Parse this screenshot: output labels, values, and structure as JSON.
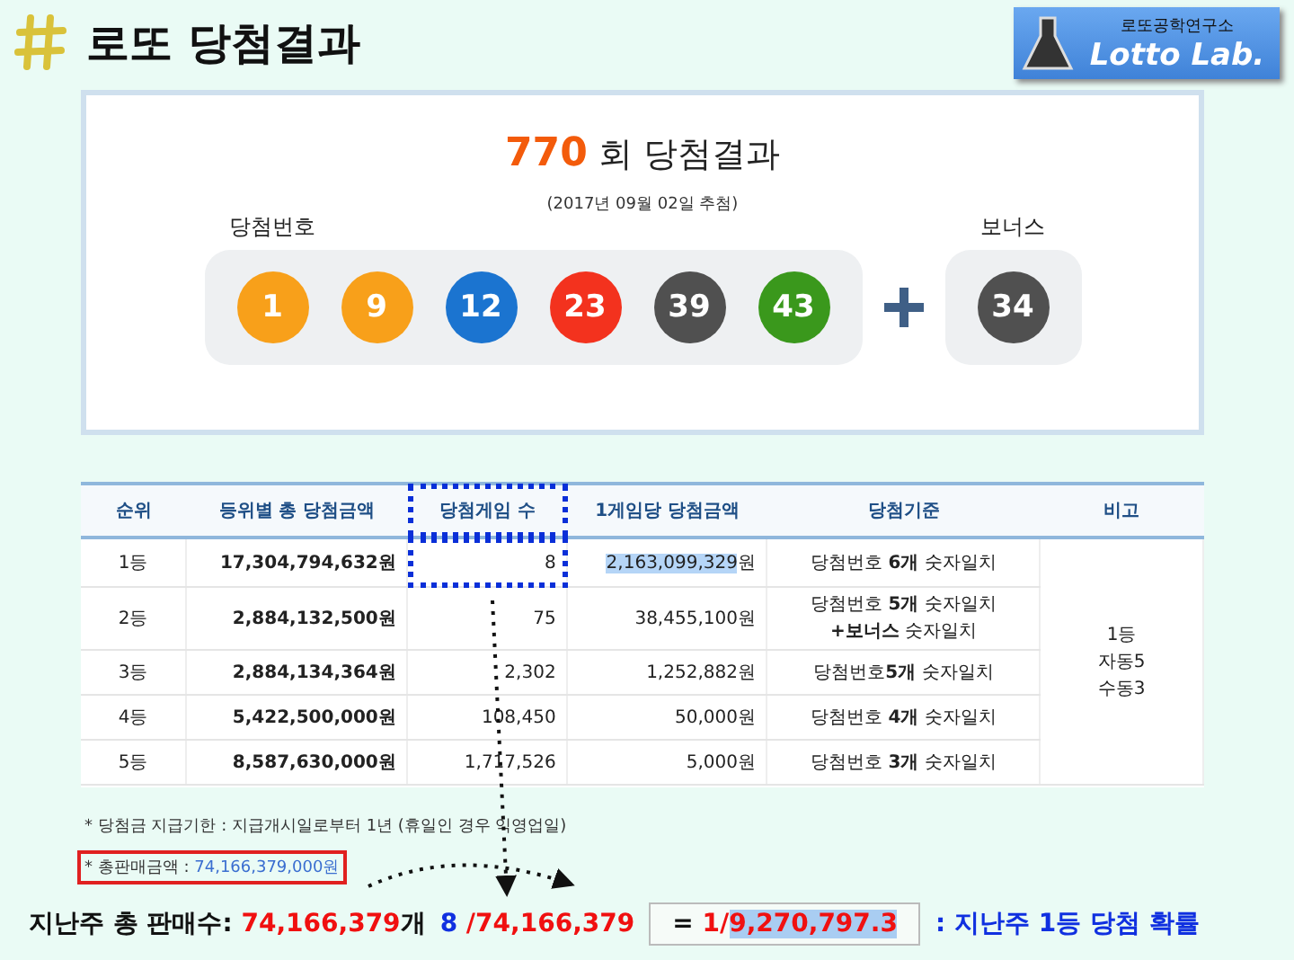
{
  "header": {
    "title": "로또 당첨결과",
    "logo": {
      "subtitle": "로또공학연구소",
      "name": "Lotto Lab."
    }
  },
  "draw": {
    "round": "770",
    "title_suffix": "회 당첨결과",
    "date": "(2017년 09월 02일 추첨)",
    "numbers_label": "당첨번호",
    "bonus_label": "보너스",
    "numbers": [
      {
        "value": "1",
        "color": "#f8a01a"
      },
      {
        "value": "9",
        "color": "#f8a01a"
      },
      {
        "value": "12",
        "color": "#1b74d0"
      },
      {
        "value": "23",
        "color": "#f3321e"
      },
      {
        "value": "39",
        "color": "#505050"
      },
      {
        "value": "43",
        "color": "#3a981c"
      }
    ],
    "bonus": {
      "value": "34",
      "color": "#505050"
    }
  },
  "table": {
    "columns": [
      {
        "label": "순위",
        "boxed": false
      },
      {
        "label": "등위별 총 당첨금액",
        "boxed": false
      },
      {
        "label": "당첨게임 수",
        "boxed": true
      },
      {
        "label": "1게임당 당첨금액",
        "boxed": false
      },
      {
        "label": "당첨기준",
        "boxed": false
      },
      {
        "label": "비고",
        "boxed": false
      }
    ],
    "rows": [
      {
        "rank": "1등",
        "total": "17,304,794,632원",
        "count": "8",
        "count_boxed": true,
        "per_game": "2,163,099,329",
        "unit": "원",
        "highlighted": true,
        "criteria": [
          "당첨번호 **6개** 숫자일치"
        ]
      },
      {
        "rank": "2등",
        "total": "2,884,132,500원",
        "count": "75",
        "count_boxed": false,
        "per_game": "38,455,100",
        "unit": "원",
        "highlighted": false,
        "criteria": [
          "당첨번호 **5개** 숫자일치",
          "**+보너스** 숫자일치"
        ]
      },
      {
        "rank": "3등",
        "total": "2,884,134,364원",
        "count": "2,302",
        "count_boxed": false,
        "per_game": "1,252,882",
        "unit": "원",
        "highlighted": false,
        "criteria": [
          "당첨번호**5개** 숫자일치"
        ]
      },
      {
        "rank": "4등",
        "total": "5,422,500,000원",
        "count": "108,450",
        "count_boxed": false,
        "per_game": "50,000",
        "unit": "원",
        "highlighted": false,
        "criteria": [
          "당첨번호 **4개** 숫자일치"
        ]
      },
      {
        "rank": "5등",
        "total": "8,587,630,000원",
        "count": "1,717,526",
        "count_boxed": false,
        "per_game": "5,000",
        "unit": "원",
        "highlighted": false,
        "criteria": [
          "당첨번호 **3개** 숫자일치"
        ]
      }
    ],
    "remark": [
      "1등",
      "자동5",
      "수동3"
    ]
  },
  "notes": [
    {
      "label": "* 당첨금 지급기한 : 지급개시일로부터 1년 (휴일인 경우 익영업일)",
      "boxed": false
    },
    {
      "label": "* 총판매금액 : ",
      "value": "74,166,379,000원",
      "boxed": true
    }
  ],
  "formula": [
    {
      "kind": "plain",
      "segments": [
        {
          "text": "지난주 총 판매수: ",
          "kind": "text",
          "highlighted": false
        },
        {
          "text": "74,166,379",
          "kind": "number",
          "highlighted": false
        },
        {
          "text": "개",
          "kind": "text",
          "highlighted": false
        }
      ]
    },
    {
      "kind": "plain",
      "segments": [
        {
          "text": "8",
          "kind": "count",
          "highlighted": false
        },
        {
          "text": " /74,166,379",
          "kind": "number",
          "highlighted": false
        }
      ]
    },
    {
      "kind": "boxed",
      "segments": [
        {
          "text": "=  ",
          "kind": "text",
          "highlighted": false
        },
        {
          "text": "1/",
          "kind": "number",
          "highlighted": false
        },
        {
          "text": "9,270,797.3",
          "kind": "number",
          "highlighted": true
        }
      ]
    },
    {
      "kind": "plain",
      "segments": [
        {
          "text": ": 지난주 1등 당첨 확률",
          "kind": "count",
          "highlighted": false
        }
      ]
    }
  ]
}
